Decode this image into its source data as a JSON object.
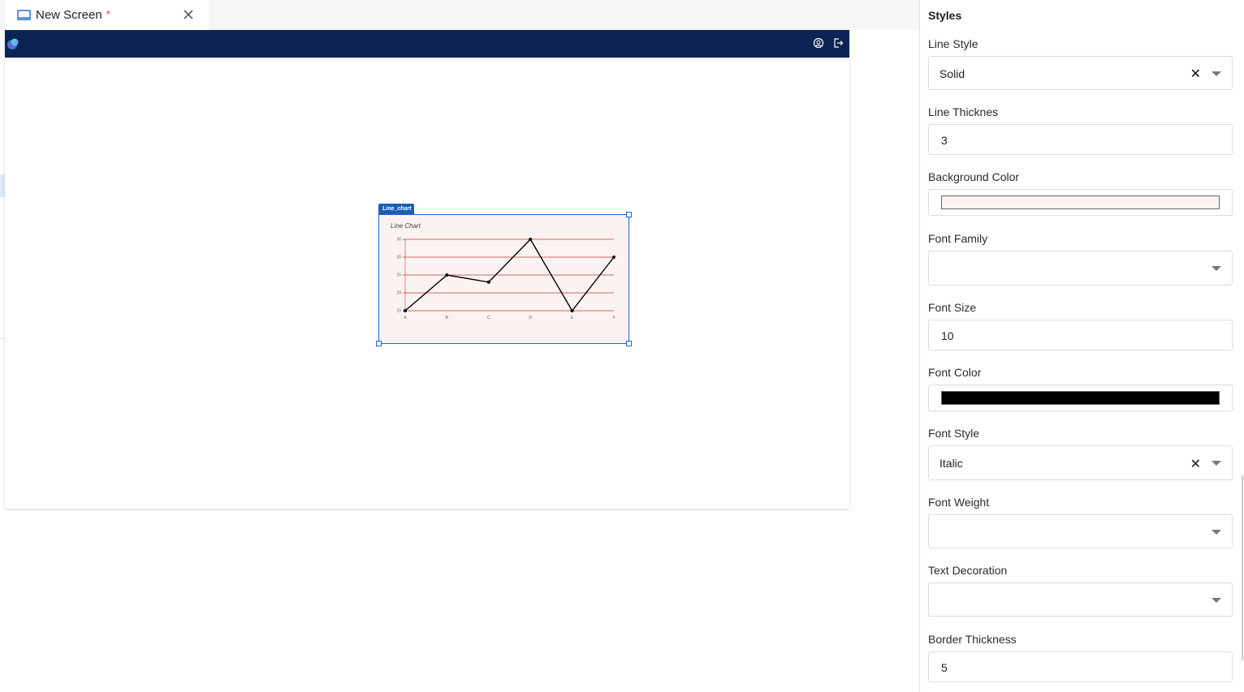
{
  "tab": {
    "title": "New Screen",
    "modified_marker": "*"
  },
  "appbar": {
    "icons": [
      "app-logo",
      "user-circle-icon",
      "logout-icon"
    ]
  },
  "widget": {
    "tag_label": "Line_chart"
  },
  "chart_data": {
    "type": "line",
    "title": "Line Chart",
    "categories": [
      "A",
      "B",
      "C",
      "D",
      "E",
      "F"
    ],
    "values": [
      15,
      25,
      23,
      35,
      15,
      30
    ],
    "ylim": [
      15,
      35
    ],
    "yticks": [
      "15",
      "20",
      "25",
      "30",
      "35"
    ],
    "grid": true,
    "line_color": "#000000",
    "grid_color": "#c0392b",
    "background": "#fbf3f2"
  },
  "panel": {
    "title": "Styles",
    "fields": {
      "line_style": {
        "label": "Line Style",
        "value": "Solid"
      },
      "line_thickness": {
        "label": "Line Thicknes",
        "value": "3"
      },
      "background_color": {
        "label": "Background Color",
        "color": "#fbf3f2"
      },
      "font_family": {
        "label": "Font Family",
        "value": ""
      },
      "font_size": {
        "label": "Font Size",
        "value": "10"
      },
      "font_color": {
        "label": "Font Color",
        "color": "#000000"
      },
      "font_style": {
        "label": "Font Style",
        "value": "Italic"
      },
      "font_weight": {
        "label": "Font Weight",
        "value": ""
      },
      "text_decoration": {
        "label": "Text Decoration",
        "value": ""
      },
      "border_thickness": {
        "label": "Border Thickness",
        "value": "5"
      }
    }
  }
}
